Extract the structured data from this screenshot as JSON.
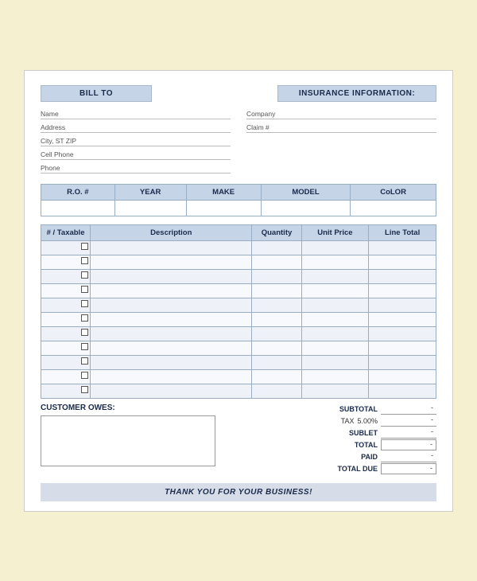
{
  "header": {
    "bill_to_label": "BILL TO",
    "insurance_label": "INSURANCE INFORMATION:"
  },
  "bill_to": {
    "name_label": "Name",
    "address_label": "Address",
    "city_label": "City, ST ZIP",
    "cell_label": "Cell Phone",
    "phone_label": "Phone"
  },
  "insurance": {
    "company_label": "Company",
    "claim_label": "Claim #"
  },
  "vehicle_table": {
    "headers": [
      "R.O. #",
      "YEAR",
      "MAKE",
      "MODEL",
      "CoLOR"
    ]
  },
  "items_table": {
    "headers": [
      "# / Taxable",
      "Description",
      "Quantity",
      "Unit Price",
      "Line Total"
    ],
    "rows": 11
  },
  "totals": {
    "subtotal_label": "SUBTOTAL",
    "tax_label": "TAX",
    "tax_pct": "5.00%",
    "sublet_label": "SUBLET",
    "total_label": "TOTAL",
    "paid_label": "PAID",
    "total_due_label": "TOTAL DUE",
    "dash": "-"
  },
  "customer_owes": {
    "label": "CUSTOMER OWES:"
  },
  "footer": {
    "text": "THANK YOU FOR YOUR BUSINESS!"
  }
}
